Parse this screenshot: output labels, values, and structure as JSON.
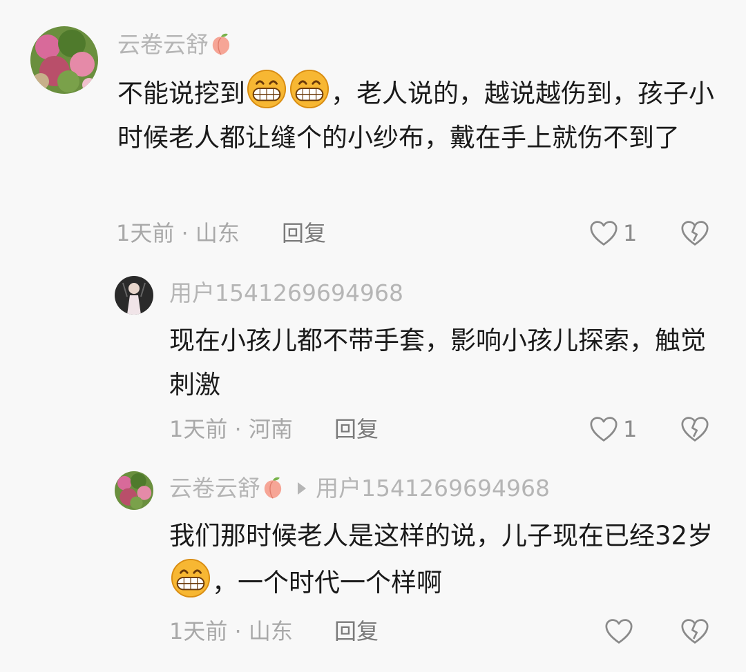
{
  "comments": [
    {
      "username": "云卷云舒",
      "username_emoji": "peach-icon",
      "text_before": "不能说挖到",
      "emojis_inline": [
        "grin-emoji",
        "grin-emoji"
      ],
      "text_after": "，老人说的，越说越伤到，孩子小时候老人都让缝个的小纱布，戴在手上就伤不到了",
      "time": "1天前",
      "location": "山东",
      "reply_label": "回复",
      "like_count": "1"
    }
  ],
  "replies": [
    {
      "username": "用户1541269694968",
      "text": "现在小孩儿都不带手套，影响小孩儿探索，触觉刺激",
      "time": "1天前",
      "location": "河南",
      "reply_label": "回复",
      "like_count": "1"
    },
    {
      "username": "云卷云舒",
      "username_emoji": "peach-icon",
      "reply_to": "用户1541269694968",
      "text_before": "我们那时候老人是这样的说，儿子现在已经32岁",
      "emojis_inline": [
        "grin-emoji"
      ],
      "text_after": "，一个时代一个样啊",
      "time": "1天前",
      "location": "山东",
      "reply_label": "回复",
      "like_count": ""
    }
  ],
  "separator": " · ",
  "colors": {
    "background": "#f8f8f8",
    "username": "#b5b5b5",
    "text": "#1a1a1a",
    "meta": "#a8a8a8"
  }
}
